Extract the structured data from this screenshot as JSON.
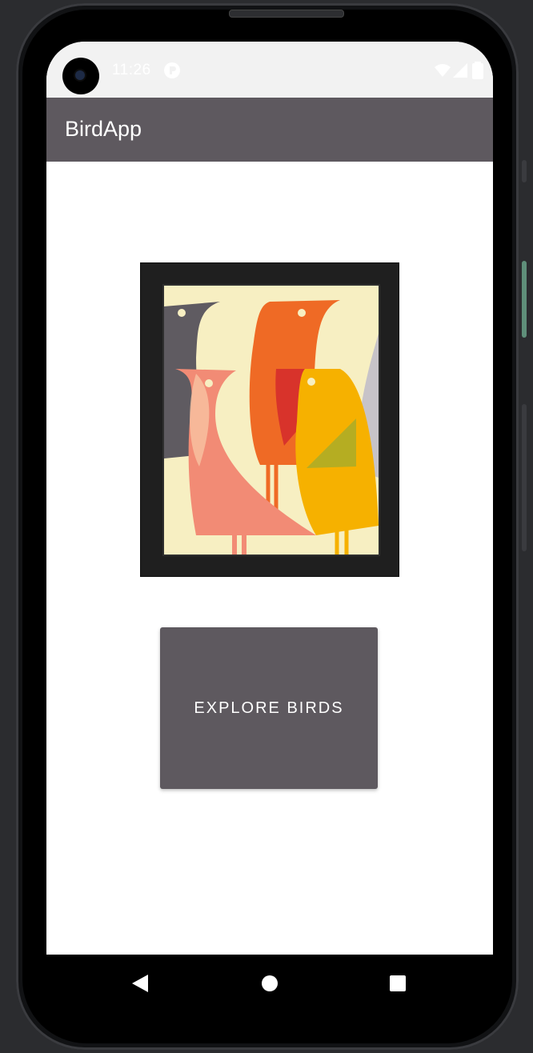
{
  "status_bar": {
    "time": "11:26",
    "icons": [
      "notification-app-icon",
      "wifi-icon",
      "signal-icon",
      "battery-icon"
    ]
  },
  "app_bar": {
    "title": "BirdApp",
    "color": "#5e595f"
  },
  "main": {
    "artwork": {
      "subject": "framed-birds-poster",
      "palette": [
        "#f7efc2",
        "#ef6a25",
        "#f28b75",
        "#f6b100",
        "#5f5b61",
        "#d8332b"
      ]
    },
    "explore_button": {
      "label": "EXPLORE BIRDS",
      "color": "#5e595f"
    }
  },
  "nav_bar": {
    "buttons": [
      "back-icon",
      "home-icon",
      "recents-icon"
    ]
  }
}
